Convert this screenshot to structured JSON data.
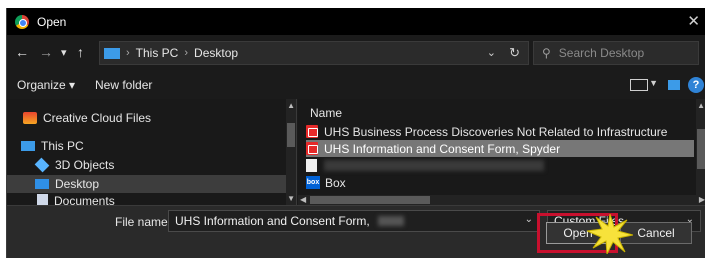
{
  "window": {
    "title": "Open",
    "close_glyph": "✕"
  },
  "nav": {
    "back_glyph": "←",
    "forward_glyph": "→",
    "recent_glyph": "▾",
    "up_glyph": "↑",
    "breadcrumb": [
      "This PC",
      "Desktop"
    ],
    "breadcrumb_separator": "›",
    "dropdown_glyph": "⌄",
    "refresh_glyph": "↻",
    "search_placeholder": "Search Desktop"
  },
  "toolbar": {
    "organize_label": "Organize ▾",
    "new_folder_label": "New folder",
    "help_glyph": "?"
  },
  "navpane": {
    "items": [
      {
        "label": "Creative Cloud Files",
        "icon": "creative-cloud-icon"
      },
      {
        "label": "This PC",
        "icon": "pc-icon"
      },
      {
        "label": "3D Objects",
        "icon": "3d-objects-icon"
      },
      {
        "label": "Desktop",
        "icon": "desktop-icon"
      },
      {
        "label": "Documents",
        "icon": "documents-icon"
      }
    ]
  },
  "filepane": {
    "column_header": "Name",
    "files": [
      {
        "name": "UHS Business Process Discoveries Not Related to Infrastructure",
        "icon": "pdf-icon"
      },
      {
        "name": "UHS Information and Consent Form, Spyder",
        "icon": "pdf-icon"
      },
      {
        "name": "",
        "icon": "doc-icon"
      },
      {
        "name": "Box",
        "icon": "box-icon"
      }
    ]
  },
  "footer": {
    "file_name_label": "File name:",
    "file_name_value": "UHS Information and Consent Form,",
    "filter_value": "Custom Files",
    "open_label": "Open",
    "cancel_label": "Cancel"
  },
  "colors": {
    "accent": "#3c9be8",
    "highlight": "#c8102e",
    "selected_row": "#777777"
  }
}
